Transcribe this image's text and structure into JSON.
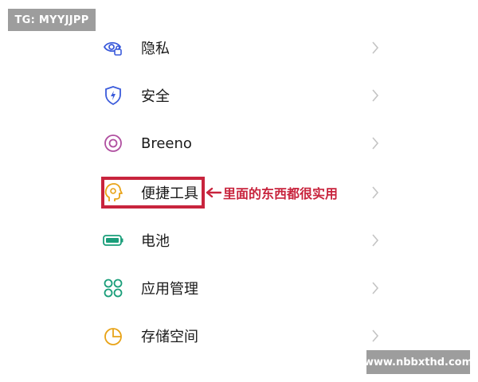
{
  "watermark_top": "TG: MYYJJPP",
  "watermark_bottom": "www.nbbxthd.com",
  "settings": [
    {
      "label": "隐私",
      "icon": "privacy-eye-lock-icon",
      "color": "#3b5bdb"
    },
    {
      "label": "安全",
      "icon": "security-shield-icon",
      "color": "#3b5bdb"
    },
    {
      "label": "Breeno",
      "icon": "breeno-ring-icon",
      "color": "#b04fa0"
    },
    {
      "label": "便捷工具",
      "icon": "convenience-tools-head-icon",
      "color": "#e8a317"
    },
    {
      "label": "电池",
      "icon": "battery-icon",
      "color": "#1a9e7a"
    },
    {
      "label": "应用管理",
      "icon": "app-management-grid-icon",
      "color": "#1a9e7a"
    },
    {
      "label": "存储空间",
      "icon": "storage-pie-icon",
      "color": "#e8a317"
    }
  ],
  "annotation": {
    "text": "里面的东西都很实用",
    "color": "#c8243d",
    "highlighted_item": "便捷工具"
  },
  "chevron_color": "#c4c4c4"
}
